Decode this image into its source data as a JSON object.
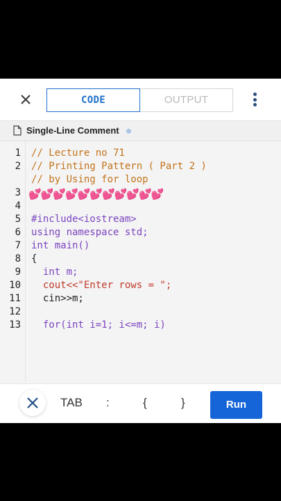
{
  "header": {
    "close_icon": "close-icon",
    "tabs": [
      {
        "label": "CODE",
        "active": true
      },
      {
        "label": "OUTPUT",
        "active": false
      }
    ],
    "more_icon": "vertical-dots-icon"
  },
  "file": {
    "icon": "file-icon",
    "name": "Single-Line Comment"
  },
  "editor": {
    "line_numbers": [
      "1",
      "2",
      "",
      "3",
      "4",
      "5",
      "6",
      "7",
      "8",
      "9",
      "10",
      "11",
      "12",
      "13"
    ],
    "lines": [
      "// Lecture no 71",
      "// Printing Pattern ( Part 2 )",
      "// by Using for loop",
      "💕💕💕💕💕💕💕💕💕💕💕",
      "#include<iostream>",
      "using namespace std;",
      "int main()",
      "{",
      "  int m;",
      "  cout<<\"Enter rows = \";",
      "  cin>>m;",
      "",
      "  for(int i=1; i<=m; i)"
    ]
  },
  "bottom": {
    "keys": [
      "TAB",
      ":",
      "{",
      "}"
    ],
    "run_label": "Run"
  },
  "colors": {
    "accent": "#1f6fc8",
    "run": "#1565d8",
    "comment": "#c2731b",
    "keyword": "#7b45c0",
    "string": "#c0392b"
  }
}
